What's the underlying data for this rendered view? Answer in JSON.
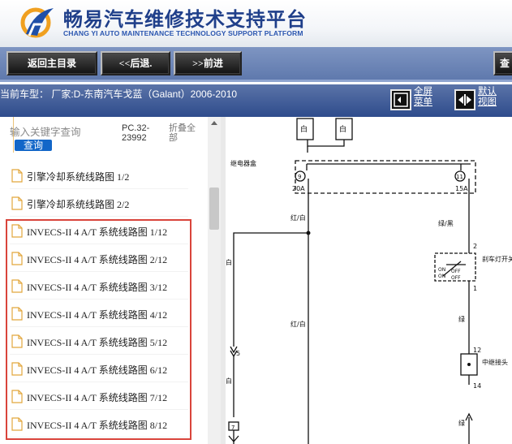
{
  "header": {
    "title_cn": "畅易汽车维修技术支持平台",
    "title_en": "CHANG YI AUTO MAINTENANCE TECHNOLOGY SUPPORT PLATFORM"
  },
  "toolbar": {
    "home_label": "返回主目录",
    "back_label": "<<后退.",
    "forward_label": ">>前进",
    "partial_label": "查"
  },
  "infobar": {
    "model_text": "当前车型：  厂家:D-东南汽车戈蓝（Galant）2006-2010",
    "fullscreen_label_1": "全屏",
    "fullscreen_label_2": "菜单",
    "default_label_1": "默认",
    "default_label_2": "视图"
  },
  "search": {
    "placeholder": "输入关键字查询",
    "button_label": "查询",
    "pc_number": "PC.32-23992",
    "collapse_label": "折叠全部"
  },
  "doc_list": [
    "引擎冷却系统线路图 1/2",
    "引擎冷却系统线路图 2/2",
    "INVECS-II 4 A/T 系统线路图 1/12",
    "INVECS-II 4 A/T 系统线路图 2/12",
    "INVECS-II 4 A/T 系统线路图 3/12",
    "INVECS-II 4 A/T 系统线路图 4/12",
    "INVECS-II 4 A/T 系统线路图 5/12",
    "INVECS-II 4 A/T 系统线路图 6/12",
    "INVECS-II 4 A/T 系统线路图 7/12",
    "INVECS-II 4 A/T 系统线路图 8/12"
  ],
  "diagram": {
    "top_label_1": "白",
    "top_label_2": "白",
    "relay_box_label": "继电器盒",
    "fuse_1_number": "9",
    "fuse_1_rating": "20A",
    "fuse_2_number": "11",
    "fuse_2_rating": "15A",
    "wire_red_white_1": "红/白",
    "wire_green_black": "绿/黑",
    "wire_white_1": "白",
    "wire_red_white_2": "红/白",
    "wire_white_2": "白",
    "wire_green_1": "绿",
    "wire_green_2": "绿",
    "pin_2": "2",
    "pin_1": "1",
    "pin_5": "5",
    "pin_7": "7",
    "pin_12": "12",
    "pin_14": "14",
    "switch_label": "刹车灯开关",
    "switch_on_1": "ON",
    "switch_off_1": "OFF",
    "switch_on_2": "ON",
    "switch_off_2": "OFF",
    "connector_label": "中继接头（"
  },
  "colors": {
    "brand_blue": "#1f3f8a",
    "toolbar_bg": "#6f87b8",
    "infobar_bg": "#3f5c99",
    "highlight_red": "#d9443b",
    "search_button": "#1266c8"
  }
}
